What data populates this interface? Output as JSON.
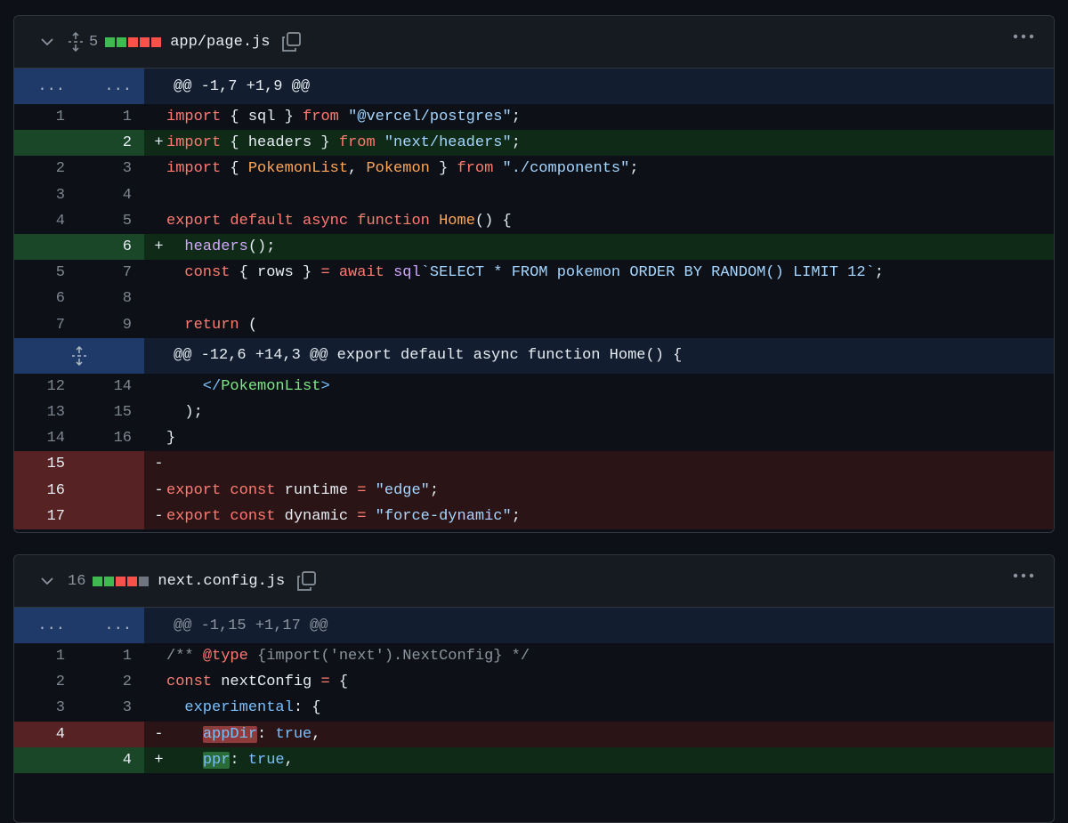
{
  "files": [
    {
      "name": "app/page.js",
      "changes": "5",
      "diffstat": [
        "#3fb950",
        "#3fb950",
        "#f85149",
        "#f85149",
        "#f85149"
      ],
      "hunks": [
        {
          "text": "@@ -1,7 +1,9 @@",
          "left": "...",
          "right": "..."
        },
        {
          "text": "@@ -12,6 +14,3 @@ export default async function Home() {"
        }
      ],
      "lines": [
        {
          "old": "1",
          "new": "1",
          "sign": ""
        },
        {
          "old": "",
          "new": "2",
          "sign": "+"
        },
        {
          "old": "2",
          "new": "3",
          "sign": ""
        },
        {
          "old": "3",
          "new": "4",
          "sign": ""
        },
        {
          "old": "4",
          "new": "5",
          "sign": ""
        },
        {
          "old": "",
          "new": "6",
          "sign": "+"
        },
        {
          "old": "5",
          "new": "7",
          "sign": ""
        },
        {
          "old": "6",
          "new": "8",
          "sign": ""
        },
        {
          "old": "7",
          "new": "9",
          "sign": ""
        },
        {
          "old": "12",
          "new": "14",
          "sign": ""
        },
        {
          "old": "13",
          "new": "15",
          "sign": ""
        },
        {
          "old": "14",
          "new": "16",
          "sign": ""
        },
        {
          "old": "15",
          "new": "",
          "sign": "-"
        },
        {
          "old": "16",
          "new": "",
          "sign": "-"
        },
        {
          "old": "17",
          "new": "",
          "sign": "-"
        }
      ],
      "code": {
        "l1": [
          "import",
          " { sql } ",
          "from",
          " ",
          "\"@vercel/postgres\"",
          ";"
        ],
        "l2": [
          "import",
          " { headers } ",
          "from",
          " ",
          "\"next/headers\"",
          ";"
        ],
        "l3": [
          "import",
          " { ",
          "PokemonList",
          ", ",
          "Pokemon",
          " } ",
          "from",
          " ",
          "\"./components\"",
          ";"
        ],
        "l5": [
          "export",
          " ",
          "default",
          " ",
          "async",
          " ",
          "function",
          " ",
          "Home",
          "() {"
        ],
        "l6": [
          "  ",
          "headers",
          "();"
        ],
        "l7": [
          "  ",
          "const",
          " { rows } ",
          "=",
          " ",
          "await",
          " ",
          "sql",
          "`SELECT * FROM pokemon ORDER BY RANDOM() LIMIT 12`",
          ";"
        ],
        "l9": [
          "  ",
          "return",
          " ("
        ],
        "l14": [
          "    </",
          "PokemonList",
          ">"
        ],
        "l15": [
          "  );"
        ],
        "l16": [
          "}"
        ],
        "l17": [
          ""
        ],
        "l18": [
          "export",
          " ",
          "const",
          " runtime ",
          "=",
          " ",
          "\"edge\"",
          ";"
        ],
        "l19": [
          "export",
          " ",
          "const",
          " dynamic ",
          "=",
          " ",
          "\"force-dynamic\"",
          ";"
        ]
      }
    },
    {
      "name": "next.config.js",
      "changes": "16",
      "diffstat": [
        "#3fb950",
        "#3fb950",
        "#f85149",
        "#f85149",
        "#6e7681"
      ],
      "hunks": [
        {
          "text": "@@ -1,15 +1,17 @@",
          "left": "...",
          "right": "..."
        }
      ],
      "lines": [
        {
          "old": "1",
          "new": "1",
          "sign": ""
        },
        {
          "old": "2",
          "new": "2",
          "sign": ""
        },
        {
          "old": "3",
          "new": "3",
          "sign": ""
        },
        {
          "old": "4",
          "new": "",
          "sign": "-"
        },
        {
          "old": "",
          "new": "4",
          "sign": "+"
        }
      ],
      "code": {
        "c1": [
          "/** ",
          "@type",
          " {import('next').NextConfig} */"
        ],
        "c2": [
          "const",
          " nextConfig ",
          "=",
          " {"
        ],
        "c3": [
          "  ",
          "experimental",
          ": {"
        ],
        "c4": [
          "    ",
          "appDir",
          ": ",
          "true",
          ","
        ],
        "c5": [
          "    ",
          "ppr",
          ": ",
          "true",
          ","
        ]
      }
    }
  ]
}
